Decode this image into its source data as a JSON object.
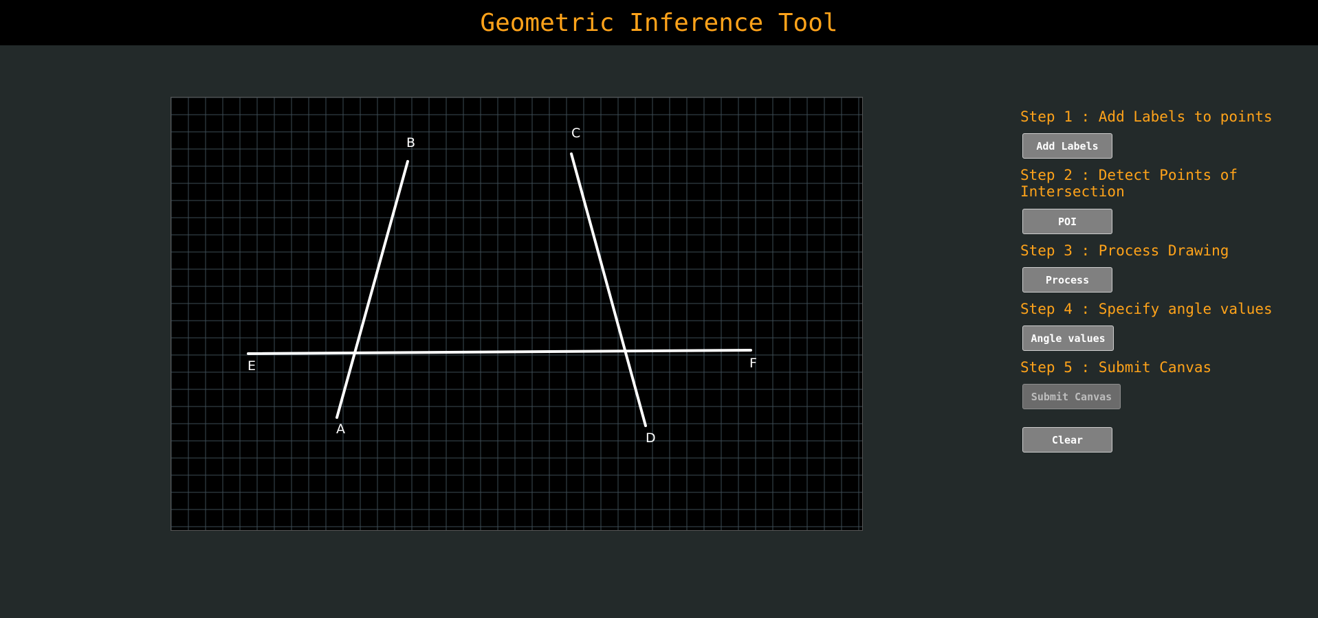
{
  "header": {
    "title": "Geometric Inference Tool"
  },
  "canvas": {
    "grid_color": "#3d4c55",
    "line_color": "#ffffff",
    "points": [
      {
        "label": "A"
      },
      {
        "label": "B"
      },
      {
        "label": "C"
      },
      {
        "label": "D"
      },
      {
        "label": "E"
      },
      {
        "label": "F"
      }
    ]
  },
  "steps": [
    {
      "label": "Step 1 : Add Labels to points",
      "button": "Add Labels"
    },
    {
      "label": "Step 2 : Detect Points of Intersection",
      "button": "POI"
    },
    {
      "label": "Step 3 : Process Drawing",
      "button": "Process"
    },
    {
      "label": "Step 4 : Specify angle values",
      "button": "Angle values"
    },
    {
      "label": "Step 5 : Submit Canvas",
      "button": "Submit Canvas",
      "disabled": true
    }
  ],
  "clear_button": "Clear",
  "colors": {
    "accent": "#ffa31a",
    "background": "#232a2a",
    "header": "#000000"
  }
}
